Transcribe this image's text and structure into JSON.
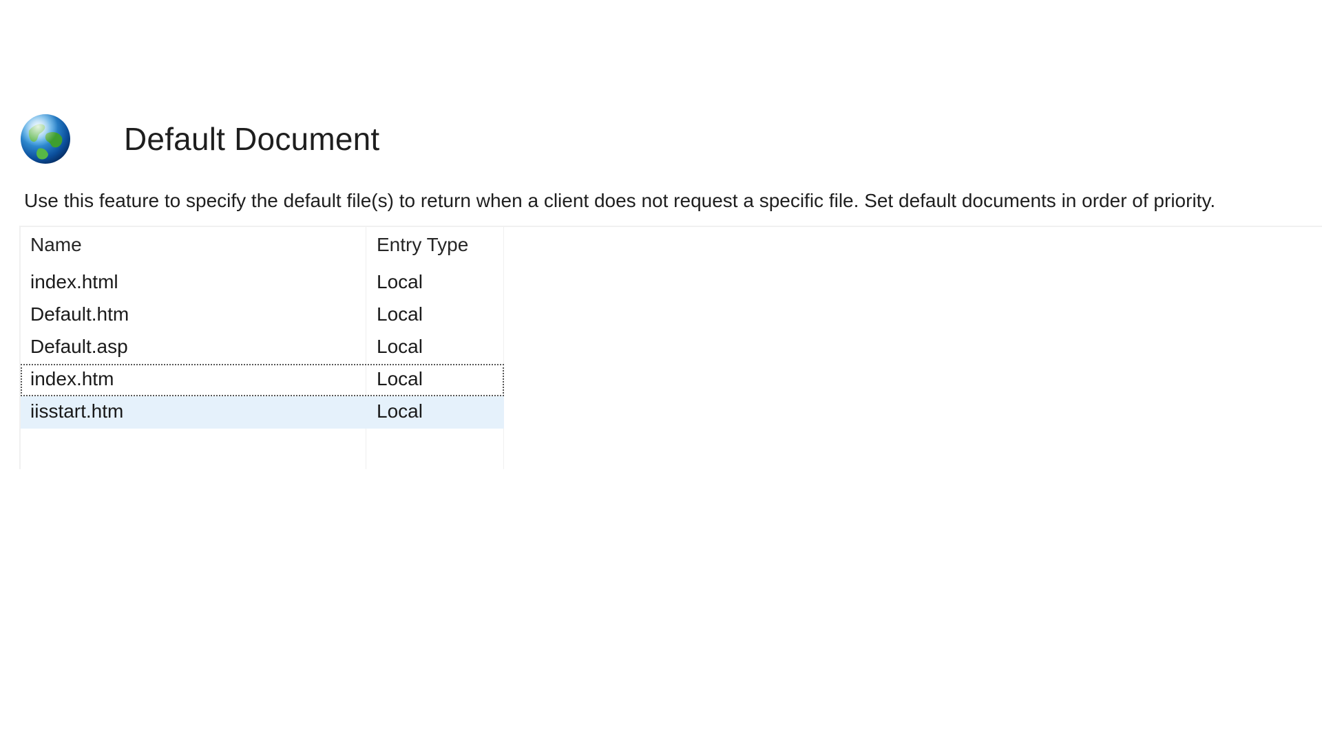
{
  "feature": {
    "icon": "globe-icon",
    "title": "Default Document",
    "description": "Use this feature to specify the default file(s) to return when a client does not request a specific file. Set default documents in order of priority."
  },
  "list": {
    "columns": [
      "Name",
      "Entry Type"
    ],
    "rows": [
      {
        "name": "index.html",
        "type": "Local",
        "state": "normal"
      },
      {
        "name": "Default.htm",
        "type": "Local",
        "state": "normal"
      },
      {
        "name": "Default.asp",
        "type": "Local",
        "state": "normal"
      },
      {
        "name": "index.htm",
        "type": "Local",
        "state": "focused"
      },
      {
        "name": "iisstart.htm",
        "type": "Local",
        "state": "selected"
      }
    ]
  },
  "colors": {
    "selected_row": "#e5f1fb",
    "text": "#1a1a1a"
  }
}
